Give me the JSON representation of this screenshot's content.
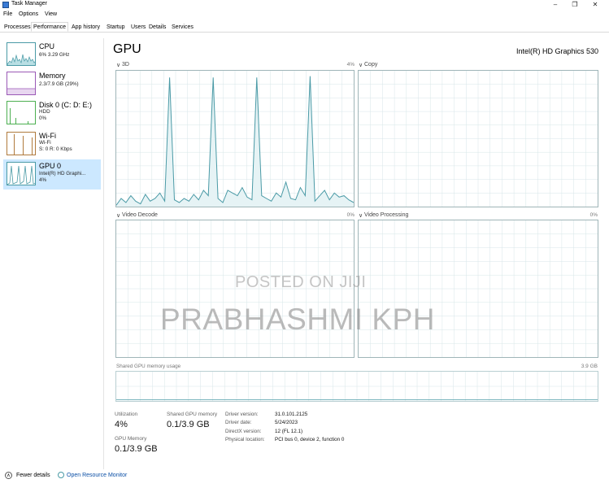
{
  "window": {
    "title": "Task Manager"
  },
  "menu": [
    "File",
    "Options",
    "View"
  ],
  "tabs": [
    "Processes",
    "Performance",
    "App history",
    "Startup",
    "Users",
    "Details",
    "Services"
  ],
  "active_tab": "Performance",
  "sidebar": {
    "items": [
      {
        "name": "CPU",
        "lines": [
          "6% 3.29 GHz"
        ],
        "icon": "cpu-graph"
      },
      {
        "name": "Memory",
        "lines": [
          "2.3/7.9 GB (29%)"
        ],
        "icon": "memory-graph"
      },
      {
        "name": "Disk 0 (C: D: E:)",
        "lines": [
          "HDD",
          "0%"
        ],
        "icon": "disk-graph"
      },
      {
        "name": "Wi-Fi",
        "lines": [
          "Wi-Fi",
          "S: 0 R: 0 Kbps"
        ],
        "icon": "wifi-graph"
      },
      {
        "name": "GPU 0",
        "lines": [
          "Intel(R) HD Graphi...",
          "4%"
        ],
        "icon": "gpu-graph",
        "selected": true
      }
    ]
  },
  "main": {
    "title": "GPU",
    "model": "Intel(R) HD Graphics 530",
    "engines": [
      {
        "name": "3D",
        "value": "4%"
      },
      {
        "name": "Copy",
        "value": ""
      },
      {
        "name": "Video Decode",
        "value": "0%"
      },
      {
        "name": "Video Processing",
        "value": "0%"
      }
    ],
    "shared_memory_graph": {
      "label": "Shared GPU memory usage",
      "max": "3.9 GB"
    },
    "stats": {
      "utilization_label": "Utilization",
      "utilization_value": "4%",
      "shared_label": "Shared GPU memory",
      "shared_value": "0.1/3.9 GB",
      "gpu_memory_label": "GPU Memory",
      "gpu_memory_value": "0.1/3.9 GB"
    },
    "details": [
      {
        "key": "Driver version:",
        "value": "31.0.101.2125"
      },
      {
        "key": "Driver date:",
        "value": "5/24/2023"
      },
      {
        "key": "DirectX version:",
        "value": "12 (FL 12.1)"
      },
      {
        "key": "Physical location:",
        "value": "PCI bus 0, device 2, function 0"
      }
    ]
  },
  "watermark": {
    "line1": "POSTED ON JIJI",
    "line2": "PRABHASHMI KPH"
  },
  "footer": {
    "fewer_details": "Fewer details",
    "open_monitor": "Open Resource Monitor"
  },
  "colors": {
    "accent": "#17a2b8",
    "gpu_line": "#4a9aa6",
    "selected": "#cce8ff",
    "link": "#0b4fa6"
  },
  "series_3d_percent": [
    1,
    6,
    3,
    8,
    4,
    2,
    9,
    4,
    6,
    10,
    4,
    95,
    5,
    3,
    6,
    4,
    9,
    5,
    12,
    8,
    95,
    6,
    3,
    12,
    10,
    8,
    14,
    7,
    5,
    95,
    8,
    6,
    4,
    10,
    7,
    18,
    6,
    5,
    14,
    8,
    96,
    4,
    8,
    12,
    5,
    10,
    7,
    8,
    5,
    3
  ]
}
